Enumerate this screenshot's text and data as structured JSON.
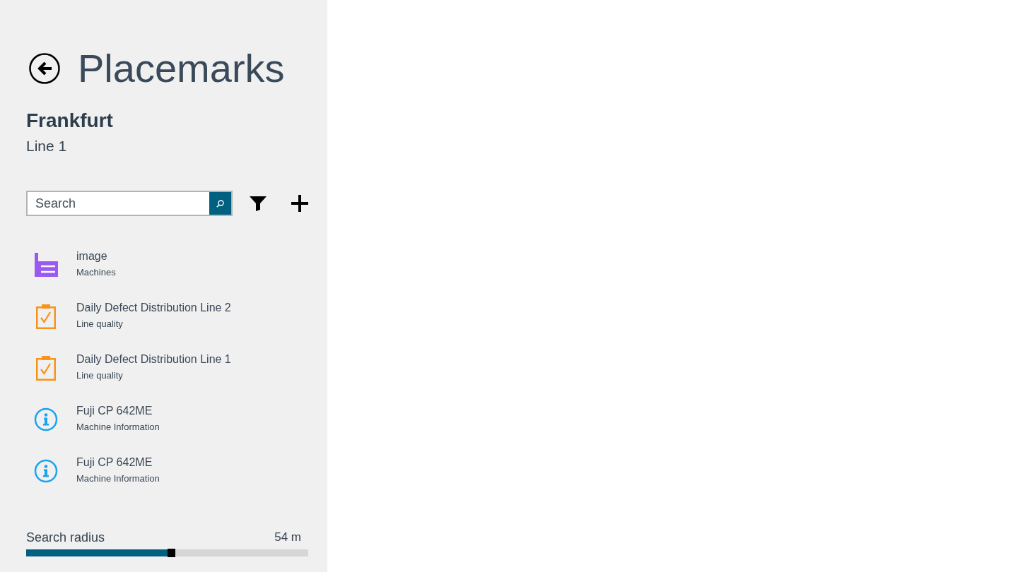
{
  "header": {
    "title": "Placemarks"
  },
  "location": {
    "name": "Frankfurt",
    "line": "Line 1"
  },
  "search": {
    "placeholder": "Search"
  },
  "placemarks": [
    {
      "kind": "machines",
      "title": "image",
      "category": "Machines"
    },
    {
      "kind": "quality",
      "title": "Daily Defect Distribution Line 2",
      "category": "Line quality"
    },
    {
      "kind": "quality",
      "title": "Daily Defect Distribution Line 1",
      "category": "Line quality"
    },
    {
      "kind": "info",
      "title": "Fuji CP 642ME",
      "category": "Machine Information"
    },
    {
      "kind": "info",
      "title": "Fuji CP 642ME",
      "category": "Machine Information"
    }
  ],
  "search_radius": {
    "label": "Search radius",
    "reading": "54 m",
    "level": 0.5
  }
}
